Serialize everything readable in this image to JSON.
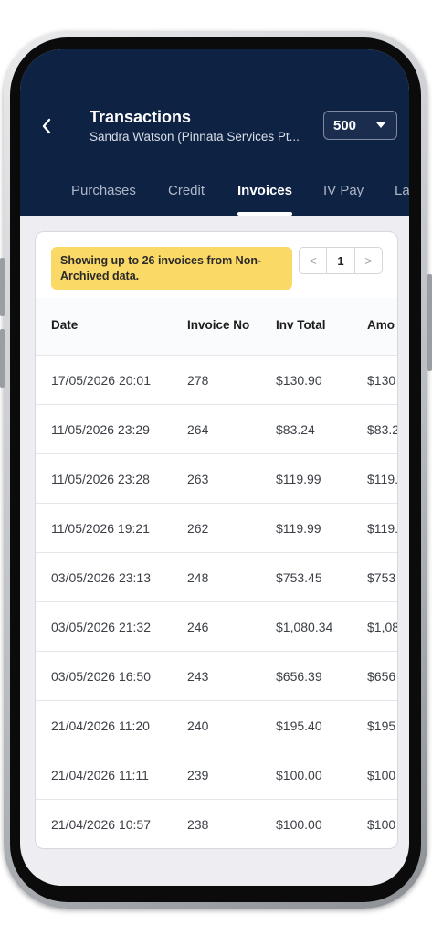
{
  "header": {
    "title": "Transactions",
    "subtitle": "Sandra Watson (Pinnata Services Pt...",
    "count_selector": {
      "value": "500"
    }
  },
  "tabs": [
    {
      "label": "Purchases",
      "active": false
    },
    {
      "label": "Credit",
      "active": false
    },
    {
      "label": "Invoices",
      "active": true
    },
    {
      "label": "IV Pay",
      "active": false
    },
    {
      "label": "La",
      "active": false
    }
  ],
  "notice": {
    "text": "Showing up to 26 invoices from Non-Archived data."
  },
  "pagination": {
    "prev": "<",
    "page": "1",
    "next": ">"
  },
  "table": {
    "columns": [
      "Date",
      "Invoice No",
      "Inv Total",
      "Amo"
    ],
    "rows": [
      [
        "17/05/2026 20:01",
        "278",
        "$130.90",
        "$130"
      ],
      [
        "11/05/2026 23:29",
        "264",
        "$83.24",
        "$83.2"
      ],
      [
        "11/05/2026 23:28",
        "263",
        "$119.99",
        "$119."
      ],
      [
        "11/05/2026 19:21",
        "262",
        "$119.99",
        "$119."
      ],
      [
        "03/05/2026 23:13",
        "248",
        "$753.45",
        "$753"
      ],
      [
        "03/05/2026 21:32",
        "246",
        "$1,080.34",
        "$1,08"
      ],
      [
        "03/05/2026 16:50",
        "243",
        "$656.39",
        "$656"
      ],
      [
        "21/04/2026 11:20",
        "240",
        "$195.40",
        "$195"
      ],
      [
        "21/04/2026 11:11",
        "239",
        "$100.00",
        "$100"
      ],
      [
        "21/04/2026 10:57",
        "238",
        "$100.00",
        "$100"
      ]
    ]
  },
  "colors": {
    "header_bg": "#0e2244",
    "notice_bg": "#fbd967",
    "screen_bg": "#eeeef2"
  },
  "icons": {
    "back": "chevron-left-icon",
    "dropdown": "caret-down-icon"
  }
}
